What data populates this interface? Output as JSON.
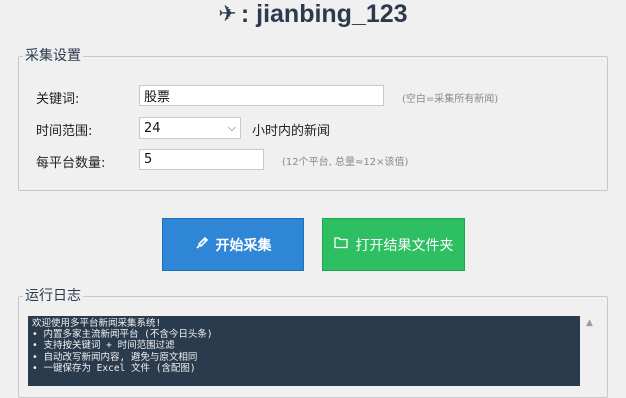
{
  "header": {
    "icon": "airplane-icon",
    "title": "jianbing_123"
  },
  "settings": {
    "legend": "采集设置",
    "keyword": {
      "label": "关键词:",
      "value": "股票",
      "hint": "(空白=采集所有新闻)"
    },
    "time_range": {
      "label": "时间范围:",
      "value": "24",
      "suffix": "小时内的新闻"
    },
    "per_platform": {
      "label": "每平台数量:",
      "value": "5",
      "hint": "(12个平台, 总量≈12×该值)"
    }
  },
  "buttons": {
    "start": {
      "label": "开始采集",
      "icon": "rocket-icon",
      "color": "#2f86d6"
    },
    "open_folder": {
      "label": "打开结果文件夹",
      "icon": "folder-icon",
      "color": "#2fbf63"
    }
  },
  "log": {
    "legend": "运行日志",
    "lines": [
      "欢迎使用多平台新闻采集系统!",
      "• 内置多家主流新闻平台 (不含今日头条)",
      "• 支持按关键词 + 时间范围过滤",
      "• 自动改写新闻内容, 避免与原文相同",
      "• 一键保存为 Excel 文件 (含配图)"
    ]
  }
}
